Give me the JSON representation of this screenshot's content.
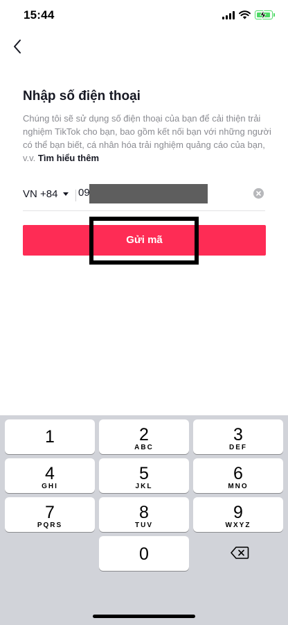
{
  "status_bar": {
    "time": "15:44",
    "icons": [
      "cellular-signal-icon",
      "wifi-icon",
      "battery-charging-icon"
    ],
    "battery_color": "#4cd964"
  },
  "header": {
    "back_icon": "chevron-left-icon",
    "title": "Nhập số điện thoại"
  },
  "description": {
    "text": "Chúng tôi sẽ sử dụng số điện thoại của bạn để cải thiện trải nghiệm TikTok cho bạn, bao gồm kết nối bạn với những người có thể bạn biết, cá nhân hóa trải nghiệm quảng cáo của bạn, v.v. ",
    "link": "Tìm hiểu thêm"
  },
  "phone": {
    "country_code": "VN +84",
    "value_prefix": "09",
    "value_redacted": true,
    "clear_icon": "clear-circle-icon"
  },
  "send_button": {
    "label": "Gửi mã",
    "color": "#fe2c55",
    "highlighted": true
  },
  "keypad": {
    "keys": [
      {
        "digit": "1",
        "letters": ""
      },
      {
        "digit": "2",
        "letters": "ABC"
      },
      {
        "digit": "3",
        "letters": "DEF"
      },
      {
        "digit": "4",
        "letters": "GHI"
      },
      {
        "digit": "5",
        "letters": "JKL"
      },
      {
        "digit": "6",
        "letters": "MNO"
      },
      {
        "digit": "7",
        "letters": "PQRS"
      },
      {
        "digit": "8",
        "letters": "TUV"
      },
      {
        "digit": "9",
        "letters": "WXYZ"
      },
      {
        "digit": "0",
        "letters": ""
      }
    ],
    "delete_icon": "backspace-icon",
    "background": "#d1d3d9"
  }
}
